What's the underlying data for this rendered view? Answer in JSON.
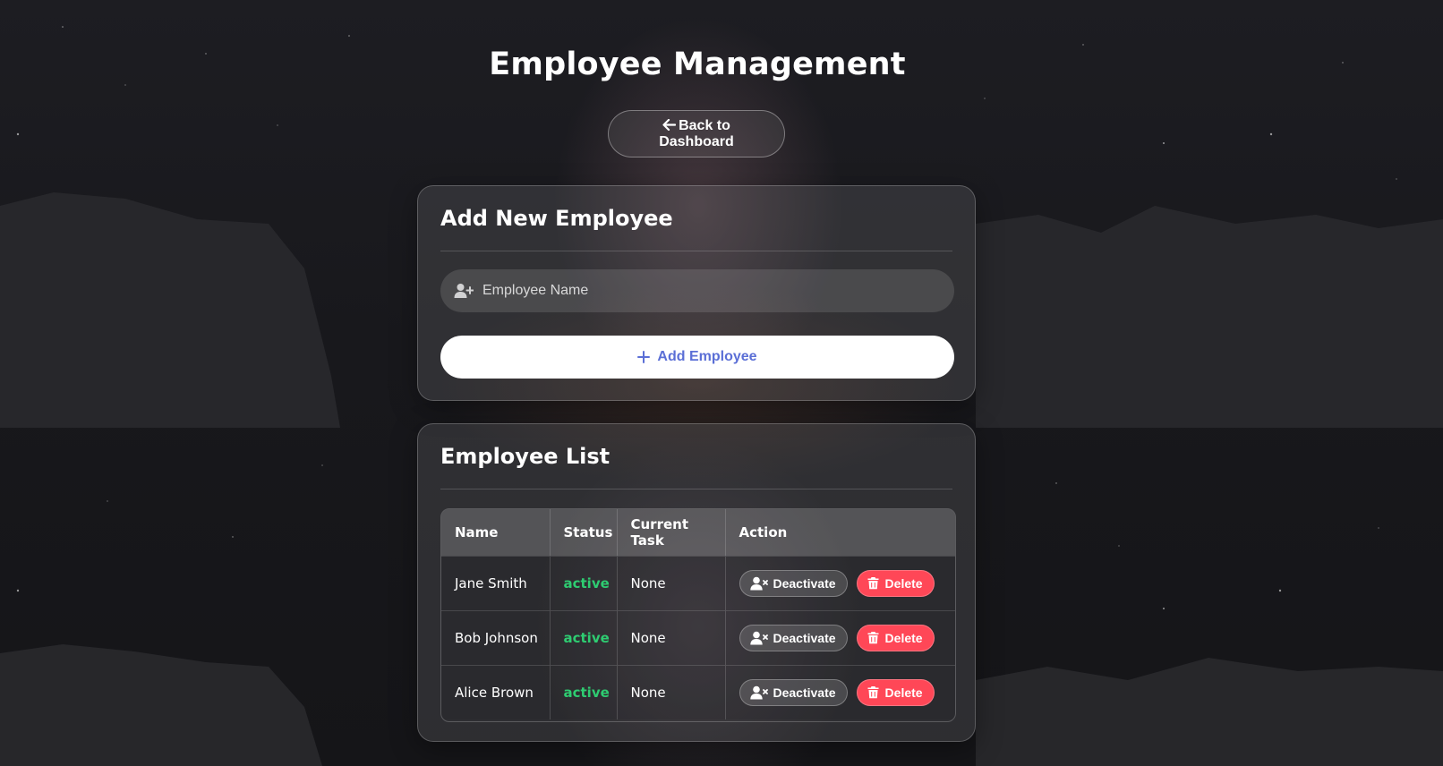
{
  "page": {
    "title": "Employee Management",
    "back_label": "Back to Dashboard"
  },
  "add_form": {
    "heading": "Add New Employee",
    "name_placeholder": "Employee Name",
    "name_value": "",
    "submit_label": "Add Employee"
  },
  "employee_list": {
    "heading": "Employee List",
    "columns": [
      "Name",
      "Status",
      "Current Task",
      "Action"
    ],
    "rows": [
      {
        "name": "Jane Smith",
        "status": "active",
        "task": "None",
        "deactivate_label": "Deactivate",
        "delete_label": "Delete"
      },
      {
        "name": "Bob Johnson",
        "status": "active",
        "task": "None",
        "deactivate_label": "Deactivate",
        "delete_label": "Delete"
      },
      {
        "name": "Alice Brown",
        "status": "active",
        "task": "None",
        "deactivate_label": "Deactivate",
        "delete_label": "Delete"
      }
    ]
  },
  "icons": {
    "back": "arrow-left-icon",
    "name_field": "user-plus-icon",
    "add": "plus-icon",
    "deactivate": "user-xmark-icon",
    "delete": "trash-icon"
  },
  "colors": {
    "status_active": "#2ecc71",
    "delete_button": "#ff4757",
    "add_button_text": "#5b6fd6"
  }
}
